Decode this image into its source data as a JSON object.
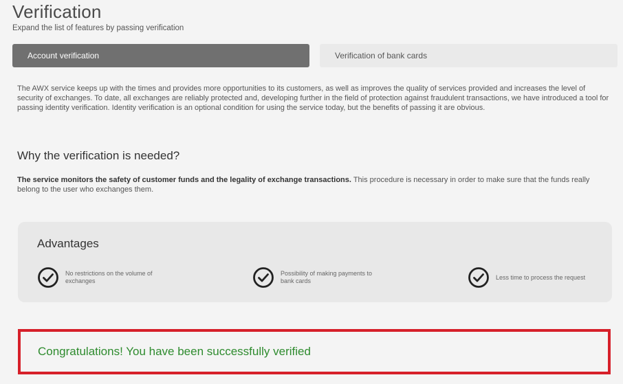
{
  "header": {
    "title": "Verification",
    "subtitle": "Expand the list of features by passing verification"
  },
  "tabs": [
    {
      "label": "Account verification",
      "active": true
    },
    {
      "label": "Verification of bank cards",
      "active": false
    }
  ],
  "intro": {
    "text": "The  AWX  service keeps up with the times and provides more opportunities to its customers, as well as improves the quality of services provided and increases the level of security of exchanges. To date, all exchanges are reliably protected and, developing further in the field of protection against fraudulent transactions, we have introduced a tool for passing identity verification. Identity verification is an optional condition for using the service today, but the benefits of passing it are obvious."
  },
  "why": {
    "heading": "Why the verification is needed?",
    "bold": "The service monitors the safety of customer funds and the legality of exchange transactions.",
    "text": " This procedure is necessary in order to make sure that the funds really belong to the user who exchanges them."
  },
  "advantages": {
    "heading": "Advantages",
    "items": [
      {
        "icon": "check-circle-icon",
        "label": "No restrictions on the volume of exchanges"
      },
      {
        "icon": "check-circle-icon",
        "label": "Possibility of making payments to bank cards"
      },
      {
        "icon": "check-circle-icon",
        "label": "Less time to process the request"
      }
    ]
  },
  "status": {
    "message": "Congratulations! You have been successfully verified",
    "text_color": "#2e8b2e",
    "border_color": "#d6202a"
  }
}
